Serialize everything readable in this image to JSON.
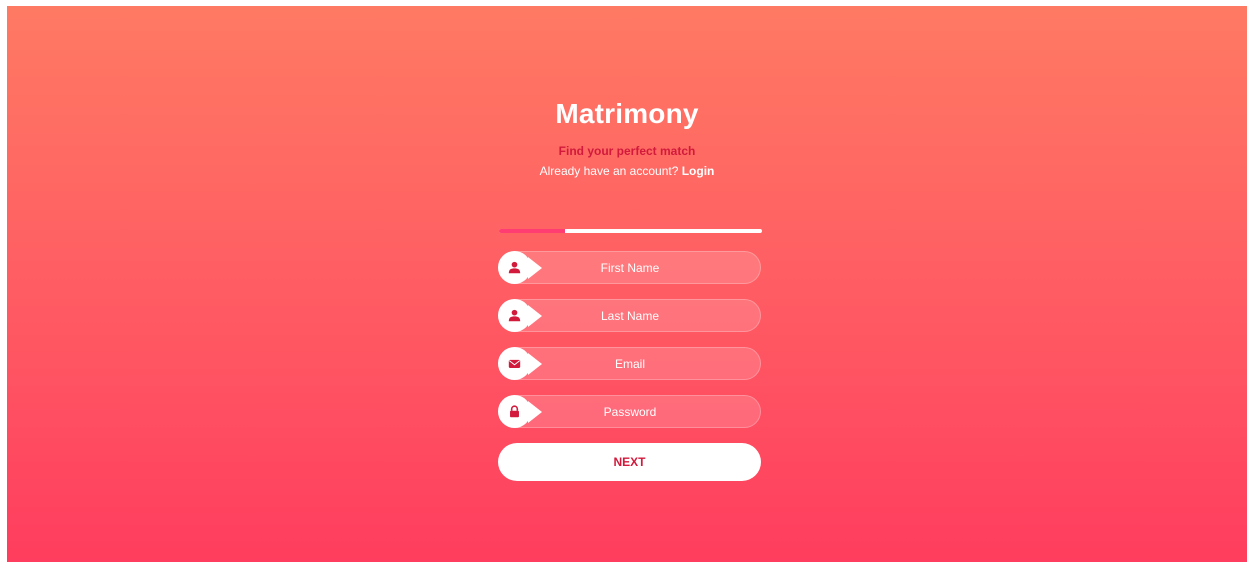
{
  "app": {
    "title": "Matrimony",
    "tagline": "Find your perfect match",
    "account_prompt": "Already have an account?",
    "login_label": "Login"
  },
  "progress": {
    "value": 0.25
  },
  "form": {
    "fields": [
      {
        "placeholder": "First Name",
        "icon": "user-icon"
      },
      {
        "placeholder": "Last Name",
        "icon": "user-icon"
      },
      {
        "placeholder": "Email",
        "icon": "envelope-icon"
      },
      {
        "placeholder": "Password",
        "icon": "lock-icon"
      }
    ],
    "next_label": "NEXT"
  },
  "colors": {
    "accent": "#d11a3c",
    "gradient_top": "#ff7a63",
    "gradient_bottom": "#ff3d5e",
    "progress_fill": "#ff3d72"
  }
}
